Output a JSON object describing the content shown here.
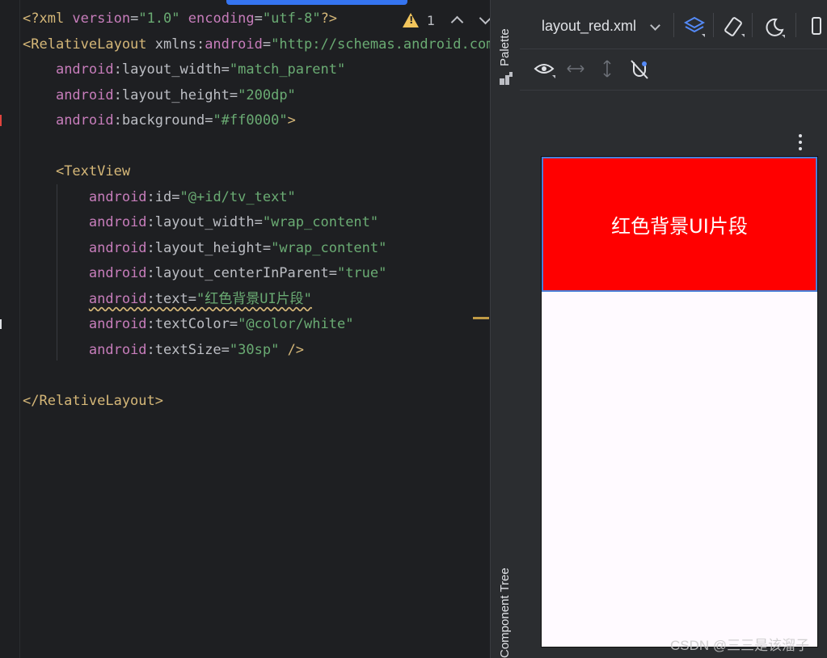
{
  "editor": {
    "lines": [
      {
        "parts": [
          {
            "c": "t",
            "v": "<?xml "
          },
          {
            "c": "a",
            "v": "version"
          },
          {
            "c": "n",
            "v": "="
          },
          {
            "c": "s",
            "v": "\"1.0\""
          },
          {
            "c": "n",
            "v": " "
          },
          {
            "c": "a",
            "v": "encoding"
          },
          {
            "c": "n",
            "v": "="
          },
          {
            "c": "s",
            "v": "\"utf-8\""
          },
          {
            "c": "t",
            "v": "?>"
          }
        ]
      },
      {
        "parts": [
          {
            "c": "t",
            "v": "<RelativeLayout "
          },
          {
            "c": "n",
            "v": "xmlns:"
          },
          {
            "c": "a",
            "v": "android"
          },
          {
            "c": "n",
            "v": "="
          },
          {
            "c": "s",
            "v": "\"http://schemas.android.com/apk/res/android\""
          }
        ]
      },
      {
        "parts": [
          {
            "c": "n",
            "v": "    "
          },
          {
            "c": "a",
            "v": "android"
          },
          {
            "c": "n",
            "v": ":layout_width="
          },
          {
            "c": "s",
            "v": "\"match_parent\""
          }
        ]
      },
      {
        "parts": [
          {
            "c": "n",
            "v": "    "
          },
          {
            "c": "a",
            "v": "android"
          },
          {
            "c": "n",
            "v": ":layout_height="
          },
          {
            "c": "s",
            "v": "\"200dp\""
          }
        ]
      },
      {
        "parts": [
          {
            "c": "n",
            "v": "    "
          },
          {
            "c": "a",
            "v": "android"
          },
          {
            "c": "n",
            "v": ":background="
          },
          {
            "c": "s",
            "v": "\"#ff0000\""
          },
          {
            "c": "t",
            "v": ">"
          }
        ]
      },
      {
        "parts": []
      },
      {
        "parts": [
          {
            "c": "n",
            "v": "    "
          },
          {
            "c": "t",
            "v": "<TextView"
          }
        ]
      },
      {
        "parts": [
          {
            "c": "n",
            "v": "        "
          },
          {
            "c": "a",
            "v": "android"
          },
          {
            "c": "n",
            "v": ":id="
          },
          {
            "c": "s",
            "v": "\"@+id/tv_text\""
          }
        ]
      },
      {
        "parts": [
          {
            "c": "n",
            "v": "        "
          },
          {
            "c": "a",
            "v": "android"
          },
          {
            "c": "n",
            "v": ":layout_width="
          },
          {
            "c": "s",
            "v": "\"wrap_content\""
          }
        ]
      },
      {
        "parts": [
          {
            "c": "n",
            "v": "        "
          },
          {
            "c": "a",
            "v": "android"
          },
          {
            "c": "n",
            "v": ":layout_height="
          },
          {
            "c": "s",
            "v": "\"wrap_content\""
          }
        ]
      },
      {
        "parts": [
          {
            "c": "n",
            "v": "        "
          },
          {
            "c": "a",
            "v": "android"
          },
          {
            "c": "n",
            "v": ":layout_centerInParent="
          },
          {
            "c": "s",
            "v": "\"true\""
          }
        ]
      },
      {
        "parts": [
          {
            "c": "n",
            "v": "        "
          },
          {
            "c": "a squig",
            "v": "android"
          },
          {
            "c": "n squig",
            "v": ":text="
          },
          {
            "c": "s squig",
            "v": "\"红色背景UI片段\""
          }
        ]
      },
      {
        "parts": [
          {
            "c": "n",
            "v": "        "
          },
          {
            "c": "a",
            "v": "android"
          },
          {
            "c": "n",
            "v": ":textColor="
          },
          {
            "c": "s",
            "v": "\"@color/white\""
          }
        ]
      },
      {
        "parts": [
          {
            "c": "n",
            "v": "        "
          },
          {
            "c": "a",
            "v": "android"
          },
          {
            "c": "n",
            "v": ":textSize="
          },
          {
            "c": "s",
            "v": "\"30sp\""
          },
          {
            "c": "t",
            "v": " />"
          }
        ]
      },
      {
        "parts": []
      },
      {
        "parts": [
          {
            "c": "t",
            "v": "</RelativeLayout>"
          }
        ]
      }
    ],
    "warning_count": "1"
  },
  "side_tabs": {
    "palette": "Palette",
    "component_tree": "Component Tree"
  },
  "design": {
    "file_name": "layout_red.xml",
    "preview_text": "红色背景UI片段",
    "preview_bg": "#ff0000",
    "preview_text_color": "#ffffff"
  },
  "watermark": "CSDN @三三是该溜子",
  "colors": {
    "tag": "#d5b778",
    "attribute": "#c77dbb",
    "string": "#6aab73",
    "selection": "#3574f0"
  }
}
